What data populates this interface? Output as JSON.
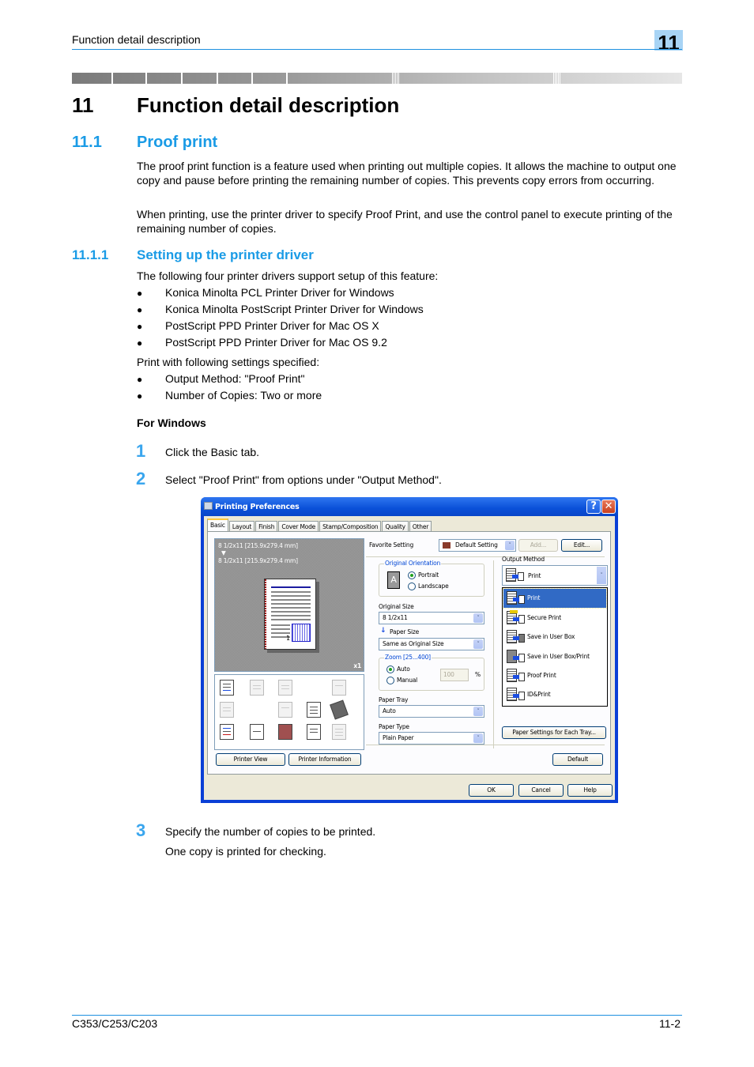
{
  "header": {
    "running_title": "Function detail description",
    "chapter_tab": "11"
  },
  "chapter": {
    "number": "11",
    "title": "Function detail description"
  },
  "section": {
    "number": "11.1",
    "title": "Proof print",
    "paragraphs": [
      "The proof print function is a feature used when printing out multiple copies. It allows the machine to output one copy and pause before printing the remaining number of copies. This prevents copy errors from occurring.",
      "When printing, use the printer driver to specify Proof Print, and use the control panel to execute printing of the remaining number of copies."
    ]
  },
  "subsection": {
    "number": "11.1.1",
    "title": "Setting up the printer driver",
    "intro": "The following four printer drivers support setup of this feature:",
    "drivers": [
      "Konica Minolta PCL Printer Driver for Windows",
      "Konica Minolta PostScript Printer Driver for Windows",
      "PostScript PPD Printer Driver for Mac OS X",
      "PostScript PPD Printer Driver for Mac OS 9.2"
    ],
    "settings_intro": "Print with following settings specified:",
    "settings": [
      "Output Method: \"Proof Print\"",
      "Number of Copies: Two or more"
    ],
    "bullet": "●",
    "windows_heading": "For Windows",
    "steps": [
      {
        "n": "1",
        "text": "Click the Basic tab."
      },
      {
        "n": "2",
        "text": "Select \"Proof Print\" from options under \"Output Method\"."
      },
      {
        "n": "3",
        "text": "Specify the number of copies to be printed.",
        "note": "One copy is printed for checking."
      }
    ]
  },
  "dialog": {
    "title": "Printing Preferences",
    "help_button": "?",
    "close_button": "✕",
    "tabs": [
      "Basic",
      "Layout",
      "Finish",
      "Cover Mode",
      "Stamp/Composition",
      "Quality",
      "Other"
    ],
    "active_tab": "Basic",
    "preview": {
      "original_size": "8 1/2x11 [215.9x279.4 mm]",
      "arrow": "▼",
      "paper_size": "8 1/2x11 [215.9x279.4 mm]",
      "copies": "x1",
      "page_number": "1"
    },
    "printer_view_button": "Printer View",
    "printer_info_button": "Printer Information",
    "favorite_label": "Favorite Setting",
    "favorite_value": "Default Setting",
    "add_button": "Add...",
    "edit_button": "Edit...",
    "orientation": {
      "group_title": "Original Orientation",
      "options": [
        "Portrait",
        "Landscape"
      ],
      "selected": "Portrait",
      "icon_letter": "A"
    },
    "original_size_label": "Original Size",
    "original_size_value": "8 1/2x11",
    "paper_size_label": "Paper Size",
    "paper_size_value": "Same as Original Size",
    "zoom": {
      "group_title": "Zoom [25...400]",
      "options": [
        "Auto",
        "Manual"
      ],
      "selected": "Auto",
      "value": "100",
      "unit": "%"
    },
    "paper_tray_label": "Paper Tray",
    "paper_tray_value": "Auto",
    "paper_type_label": "Paper Type",
    "paper_type_value": "Plain Paper",
    "output_method_label": "Output Method",
    "output_method_value": "Print",
    "output_method_options": [
      "Print",
      "Secure Print",
      "Save in User Box",
      "Save in User Box/Print",
      "Proof Print",
      "ID&Print"
    ],
    "output_method_highlighted": "Print",
    "paper_settings_button": "Paper Settings for Each Tray...",
    "default_button": "Default",
    "ok_button": "OK",
    "cancel_button": "Cancel",
    "help_bottom_button": "Help",
    "dropdown_arrow": "˅"
  },
  "footer": {
    "model": "C353/C253/C203",
    "page": "11-2"
  }
}
